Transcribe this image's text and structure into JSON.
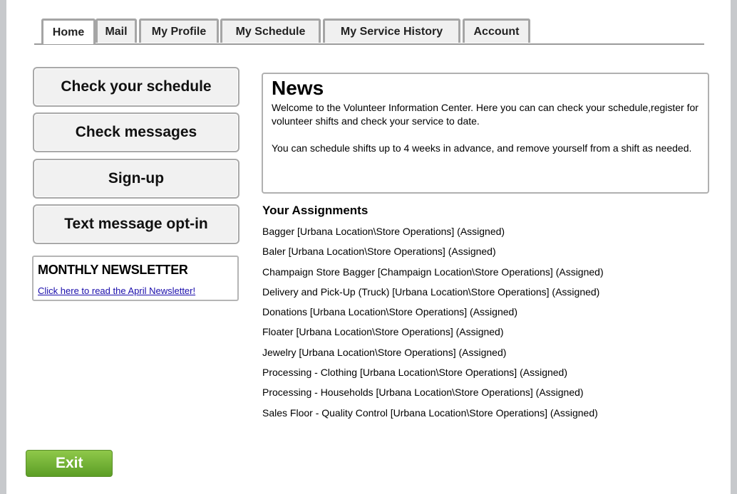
{
  "tabs": [
    {
      "label": "Home",
      "active": true
    },
    {
      "label": "Mail"
    },
    {
      "label": "My Profile"
    },
    {
      "label": "My Schedule"
    },
    {
      "label": "My Service History"
    },
    {
      "label": "Account"
    }
  ],
  "sidebar": {
    "buttons": [
      "Check your schedule",
      "Check messages",
      "Sign-up",
      "Text message opt-in"
    ],
    "newsletter": {
      "title": "MONTHLY NEWSLETTER",
      "link": "Click here to read the April Newsletter!"
    }
  },
  "news": {
    "title": "News",
    "paragraph1": "Welcome to the Volunteer Information Center. Here you can can check your schedule,register for volunteer shifts and check your service to date.",
    "paragraph2": "You can schedule shifts up to 4 weeks in advance, and remove yourself from a shift as needed."
  },
  "assignments": {
    "title": "Your Assignments",
    "items": [
      "Bagger [Urbana Location\\Store Operations] (Assigned)",
      "Baler [Urbana Location\\Store Operations] (Assigned)",
      "Champaign Store Bagger [Champaign Location\\Store Operations] (Assigned)",
      "Delivery and Pick-Up (Truck) [Urbana Location\\Store Operations] (Assigned)",
      "Donations [Urbana Location\\Store Operations] (Assigned)",
      "Floater [Urbana Location\\Store Operations] (Assigned)",
      "Jewelry [Urbana Location\\Store Operations] (Assigned)",
      "Processing - Clothing [Urbana Location\\Store Operations] (Assigned)",
      "Processing - Households [Urbana Location\\Store Operations] (Assigned)",
      "Sales Floor - Quality Control [Urbana Location\\Store Operations] (Assigned)"
    ]
  },
  "exit_label": "Exit",
  "colors": {
    "frame": "#c7c9cc",
    "exit_green": "#6fb032",
    "link": "#1a0dab"
  }
}
